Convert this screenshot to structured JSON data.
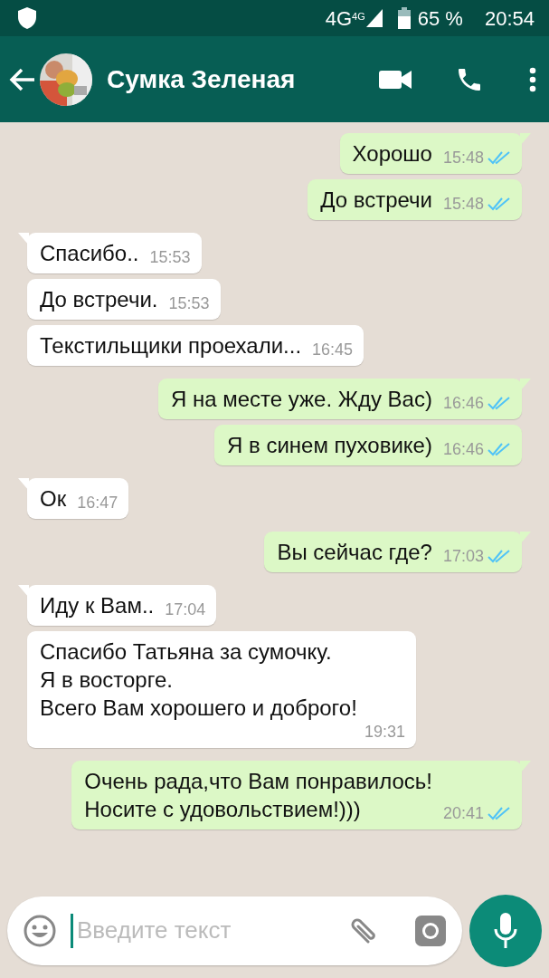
{
  "status_bar": {
    "network": "4G",
    "network_small": "4G",
    "battery": "65 %",
    "time": "20:54"
  },
  "header": {
    "contact": "Сумка Зеленая"
  },
  "messages": [
    {
      "kind": "outgoing",
      "tail": true,
      "text": "Хорошо",
      "time": "15:48",
      "read": true
    },
    {
      "kind": "outgoing",
      "tail": false,
      "text": "До встречи",
      "time": "15:48",
      "read": true
    },
    {
      "kind": "incoming",
      "tail": true,
      "text": "Спасибо..",
      "time": "15:53"
    },
    {
      "kind": "incoming",
      "tail": false,
      "text": "До встречи.",
      "time": "15:53"
    },
    {
      "kind": "incoming",
      "tail": false,
      "text": "Текстильщики проехали...",
      "time": "16:45"
    },
    {
      "kind": "outgoing",
      "tail": true,
      "text": "Я на месте уже. Жду Вас)",
      "time": "16:46",
      "read": true
    },
    {
      "kind": "outgoing",
      "tail": false,
      "text": "Я в синем пуховике)",
      "time": "16:46",
      "read": true
    },
    {
      "kind": "incoming",
      "tail": true,
      "text": "Ок",
      "time": "16:47"
    },
    {
      "kind": "outgoing",
      "tail": true,
      "text": "Вы сейчас где?",
      "time": "17:03",
      "read": true
    },
    {
      "kind": "incoming",
      "tail": true,
      "text": "Иду к Вам..",
      "time": "17:04"
    },
    {
      "kind": "incoming",
      "tail": false,
      "text": "Спасибо Татьяна за сумочку.\nЯ в восторге.\nВсего Вам хорошего и доброго!",
      "time": "19:31"
    },
    {
      "kind": "outgoing",
      "tail": true,
      "text": "Очень рада,что Вам понравилось!\nНосите с удовольствием!)))",
      "time": "20:41",
      "read": true
    }
  ],
  "composer": {
    "placeholder": "Введите текст"
  }
}
